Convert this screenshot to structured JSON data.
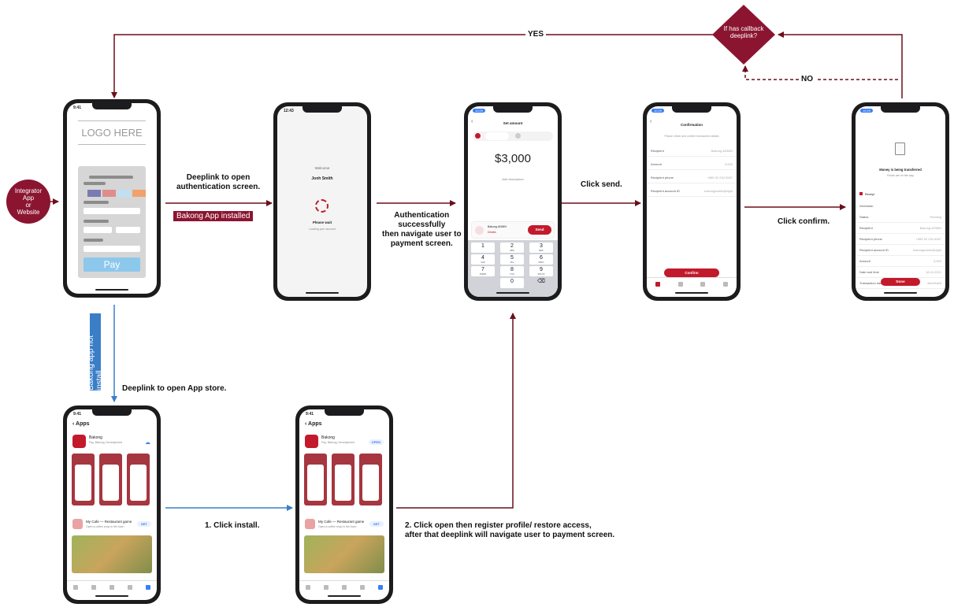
{
  "nodes": {
    "integrator": "Integrator App\nor\nWebsite",
    "callback_decision": "If has callback deeplink?"
  },
  "edges": {
    "yes": "YES",
    "no": "NO",
    "deeplink_auth": "Deeplink to open\nauthentication screen.",
    "bakong_installed": "Bakong App installed",
    "auth_success": "Authentication\nsuccessfully\nthen navigate user to\npayment screen.",
    "click_send": "Click send.",
    "click_confirm": "Click confirm.",
    "not_install": "Bakong app not install",
    "deeplink_store": "Deeplink to open App store.",
    "click_install": "1. Click install.",
    "click_open": "2. Click open then register profile/ restore access,\nafter that deeplink will navigate user to payment screen."
  },
  "colors": {
    "brand": "#8b1530",
    "flow": "#6b0f1a",
    "store_flow": "#3a7ec7"
  },
  "phone1": {
    "time": "9:41",
    "logo": "LOGO HERE",
    "pay": "Pay"
  },
  "phone2": {
    "time": "12:43",
    "welcome": "Welcome",
    "name": "Jonh Smith",
    "wait": "Please wait",
    "loading": "Loading your account"
  },
  "phone3": {
    "time": "10:29",
    "title": "Set amount",
    "currency": "$",
    "amount": "3,000",
    "desc": "Add description",
    "recipient_name": "Bakong ADMIN",
    "details": "Details",
    "send": "Send",
    "keys": [
      {
        "n": "1",
        "l": ""
      },
      {
        "n": "2",
        "l": "ABC"
      },
      {
        "n": "3",
        "l": "DEF"
      },
      {
        "n": "4",
        "l": "GHI"
      },
      {
        "n": "5",
        "l": "JKL"
      },
      {
        "n": "6",
        "l": "MNO"
      },
      {
        "n": "7",
        "l": "PQRS"
      },
      {
        "n": "8",
        "l": "TUV"
      },
      {
        "n": "9",
        "l": "WXYZ"
      },
      {
        "n": "0",
        "l": ""
      }
    ]
  },
  "phone4": {
    "time": "10:29",
    "title": "Confirmation",
    "subtitle": "Please check and confirm transaction details",
    "rows": [
      {
        "k": "Recipient",
        "v": "Bakong ADMIN"
      },
      {
        "k": "Amount",
        "v": "3,000"
      },
      {
        "k": "Recipient phone",
        "v": "+855 92 234 5067"
      },
      {
        "k": "Recipient account ID",
        "v": "bakongadmin@dgbt"
      }
    ],
    "confirm": "Confirm"
  },
  "phone5": {
    "time": "10:29",
    "heading": "Money is being transferred",
    "sub": "Funds are on the way",
    "receipt": "Receipt",
    "info": "Information",
    "rows": [
      {
        "k": "Status",
        "v": "Pending"
      },
      {
        "k": "Recipient",
        "v": "Bakong ADMIN"
      },
      {
        "k": "Recipient phone",
        "v": "+855 92 234 5067"
      },
      {
        "k": "Recipient account ID",
        "v": "bakongadmin@dgbt"
      },
      {
        "k": "Amount",
        "v": "3,000"
      },
      {
        "k": "Date and time",
        "v": "18.10.2021"
      },
      {
        "k": "Transaction hash",
        "v": "8ae04ab6"
      }
    ],
    "done": "Done"
  },
  "store1": {
    "time": "9:41",
    "nav": "Apps",
    "app": "Bakong",
    "app_sub": "Pay, Bakong, Development",
    "game": "My Cafe — Restaurant game",
    "game_sub": "Open a coffee shop in the town",
    "get": "GET"
  },
  "store2": {
    "time": "9:41",
    "nav": "Apps",
    "app": "Bakong",
    "app_sub": "Pay, Bakong, Development",
    "open": "OPEN",
    "game": "My Cafe — Restaurant game",
    "game_sub": "Open a coffee shop in the town",
    "get": "GET"
  }
}
